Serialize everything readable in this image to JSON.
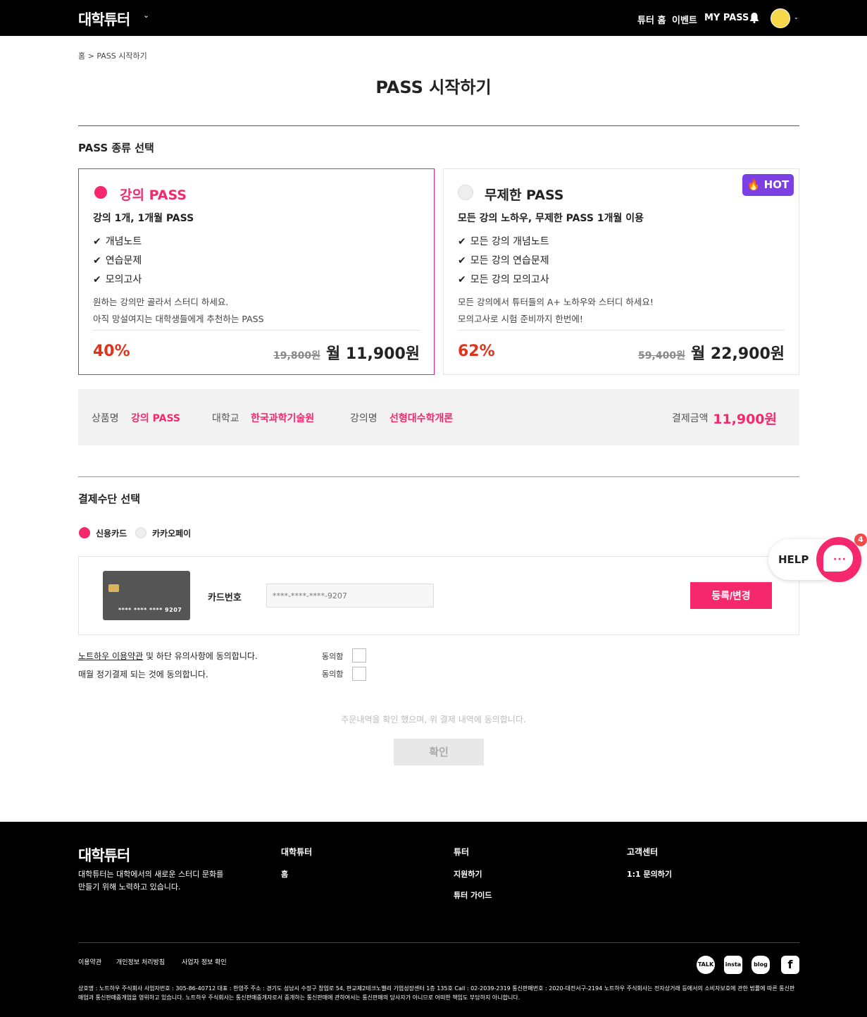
{
  "header": {
    "logo": "대학튜터",
    "nav": [
      "튜터 홈",
      "이벤트",
      "MY PASS"
    ]
  },
  "breadcrumb": "홈 > PASS 시작하기",
  "page_title": "PASS 시작하기",
  "pass_section": {
    "title": "PASS 종류 선택",
    "cards": [
      {
        "name": "강의 PASS",
        "subtitle": "강의 1개, 1개월 PASS",
        "features": [
          "개념노트",
          "연습문제",
          "모의고사"
        ],
        "desc1": "원하는 강의만 골라서 스터디 하세요.",
        "desc2": "아직 망설여지는 대학생들에게 추천하는 PASS",
        "discount": "40%",
        "old_price": "19,800원",
        "price": "월 11,900원",
        "selected": true
      },
      {
        "name": "무제한 PASS",
        "subtitle": "모든 강의 노하우, 무제한 PASS 1개월 이용",
        "features": [
          "모든 강의 개념노트",
          "모든 강의 연습문제",
          "모든 강의 모의고사"
        ],
        "desc1": "모든 강의에서 튜터들의 A+ 노하우와 스터디 하세요!",
        "desc2": "모의고사로 시험 준비까지 한번에!",
        "discount": "62%",
        "old_price": "59,400원",
        "price": "월 22,900원",
        "badge": "🔥 HOT",
        "selected": false
      }
    ]
  },
  "summary": {
    "product_label": "상품명",
    "product": "강의 PASS",
    "school_label": "대학교",
    "school": "한국과학기술원",
    "lecture_label": "강의명",
    "lecture": "선형대수학개론",
    "total_label": "결제금액",
    "total": "11,900원"
  },
  "payment": {
    "title": "결제수단 선택",
    "methods": [
      "신용카드",
      "카카오페이"
    ],
    "card_masked": "**** **** **** 9207",
    "card_label": "카드번호",
    "card_input_placeholder": "****-****-****-9207",
    "register_button": "등록/변경"
  },
  "agreements": {
    "terms_link": "노트하우 이용약관",
    "terms_rest": " 및 하단 유의사항에 동의합니다.",
    "recurring": "매월 정기결제 되는 것에 동의합니다.",
    "agree_label": "동의함"
  },
  "confirm_text": "주문내역을 확인 했으며, 위 결제 내역에 동의합니다.",
  "confirm_button": "확인",
  "help": {
    "label": "HELP",
    "badge": "4",
    "dots": "···"
  },
  "footer": {
    "logo": "대학튜터",
    "desc1": "대학튜터는 대학에서의 새로운 스터디 문화를",
    "desc2": "만들기 위해 노력하고 있습니다.",
    "cols": [
      {
        "title": "대학튜터",
        "items": [
          "홈"
        ]
      },
      {
        "title": "튜터",
        "items": [
          "지원하기",
          "튜터 가이드"
        ]
      },
      {
        "title": "고객센터",
        "items": [
          "1:1 문의하기"
        ]
      }
    ],
    "links": [
      "이용약관",
      "개인정보 처리방침",
      "사업자 정보 확인"
    ],
    "social": [
      "TALK",
      "insta",
      "blog",
      "f"
    ],
    "biz": "상호명 : 노트하우 주식회사 사업자번호 : 305-86-40712 대표 : 한영주 주소 : 경기도 성남시 수정구 창업로 54, 판교제2테크노밸리 기업성장센터 1층 135호 Call : 02-2039-2319 통신판매번호 : 2020-대전서구-2194 노트하우 주식회사는 전자상거래 등에서의 소비자보호에 관한 법률에 따른 통신판매업과 통신판매중개업을 영위하고 있습니다. 노트하우 주식회사는 통신판매중개자로서 중개하는 통신판매에 관하여서는 통신판매의 당사자가 아니므로 어떠한 책임도 부담하지 아니합니다."
  },
  "colors": {
    "accent": "#f5286e",
    "discount": "#e3321b",
    "hot": "#7b3fe4"
  }
}
